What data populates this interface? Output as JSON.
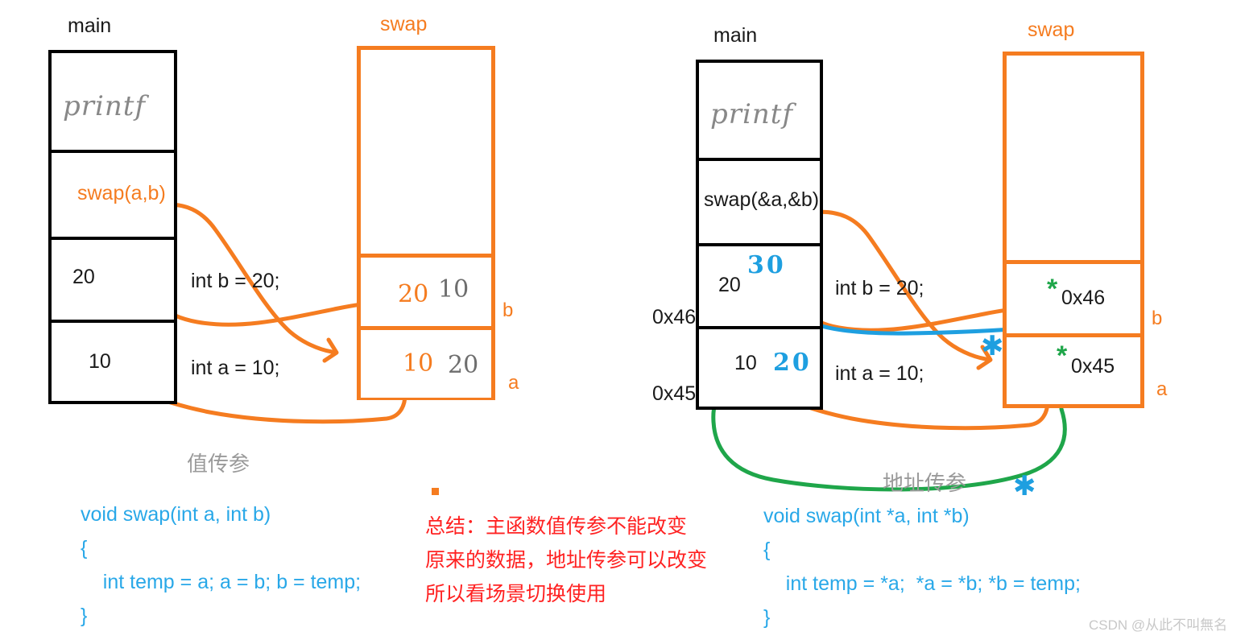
{
  "meta": {
    "watermark": "CSDN @从此不叫無名",
    "colors": {
      "orange": "#F57C20",
      "blue_code": "#29A8E8",
      "blue_ink": "#1E9FE0",
      "green_ink": "#1FA64A",
      "red_note": "#FF2222",
      "gray_ink": "#9a9a9a",
      "black": "#000000"
    }
  },
  "left_panel": {
    "caption": "值传参",
    "main_frame": {
      "title": "main",
      "cells": [
        {
          "label": "printf",
          "style": "handwritten-gray"
        },
        {
          "label": "swap(a,b)",
          "style": "orange-text"
        },
        {
          "label": "20",
          "style": "plain"
        },
        {
          "label": "10",
          "style": "plain"
        }
      ]
    },
    "statements": [
      {
        "text": "int b = 20;"
      },
      {
        "text": "int a = 10;"
      }
    ],
    "swap_frame": {
      "title": "swap",
      "cells": [
        {
          "name": "",
          "contents": []
        },
        {
          "name": "b",
          "contents": [
            {
              "text": "20",
              "style": "orange-strikethrough"
            },
            {
              "text": "10",
              "style": "gray-handwritten"
            }
          ]
        },
        {
          "name": "a",
          "contents": [
            {
              "text": "10",
              "style": "orange-strikethrough"
            },
            {
              "text": "20",
              "style": "gray-handwritten"
            }
          ]
        }
      ]
    },
    "code": "void swap(int a, int b)\n{\n    int temp = a; a = b; b = temp;\n}"
  },
  "center_note": {
    "lines": [
      "总结：主函数值传参不能改变",
      "原来的数据，地址传参可以改变",
      "所以看场景切换使用"
    ]
  },
  "right_panel": {
    "caption": "地址传参",
    "main_frame": {
      "title": "main",
      "cells": [
        {
          "label": "printf",
          "style": "handwritten-gray"
        },
        {
          "label": "swap(&a,&b)",
          "style": "plain"
        },
        {
          "label": "20",
          "style": "plain",
          "ink_note": "30",
          "ink_strike": true,
          "address": "0x46"
        },
        {
          "label": "10",
          "style": "plain",
          "ink_note": "20",
          "ink_strike": true,
          "address": "0x45"
        }
      ]
    },
    "statements": [
      {
        "text": "int b = 20;"
      },
      {
        "text": "int a = 10;"
      }
    ],
    "swap_frame": {
      "title": "swap",
      "cells": [
        {
          "name": "",
          "contents": []
        },
        {
          "name": "b",
          "contents": [
            {
              "text": "0x46",
              "style": "plain",
              "marker": "*"
            }
          ]
        },
        {
          "name": "a",
          "contents": [
            {
              "text": "0x45",
              "style": "plain",
              "marker": "*"
            }
          ]
        }
      ]
    },
    "code": "void swap(int *a, int *b)\n{\n    int temp = *a;  *a = *b; *b = temp;\n}"
  }
}
